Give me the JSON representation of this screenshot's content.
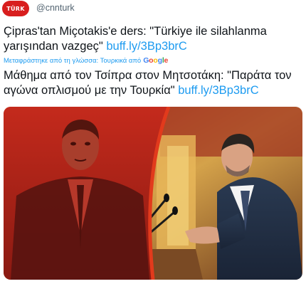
{
  "account": {
    "handle": "@cnnturk",
    "avatar_logo": "TÜRK"
  },
  "tweet": {
    "turkish_text": "Çipras'tan Miçotakis'e ders: \"Türkiye ile silahlanma yarışından vazgeç\"",
    "turkish_link": "buff.ly/3Bp3brC",
    "translation_note": "Μεταφράστηκε από τη γλώσσα: Τουρκικά από",
    "translation_provider": "Google",
    "greek_text": "Μάθημα από τον Τσίπρα στον Μητσοτάκη: \"Παράτα τον αγώνα οπλισμού με την Τουρκία\"",
    "greek_link": "buff.ly/3Bp3brC"
  },
  "media": {
    "description_left": "red-tinted-portrait",
    "description_right": "speaker-at-podium",
    "left_tint": "#d42a1e",
    "accent_arc": "#e23a1c"
  }
}
